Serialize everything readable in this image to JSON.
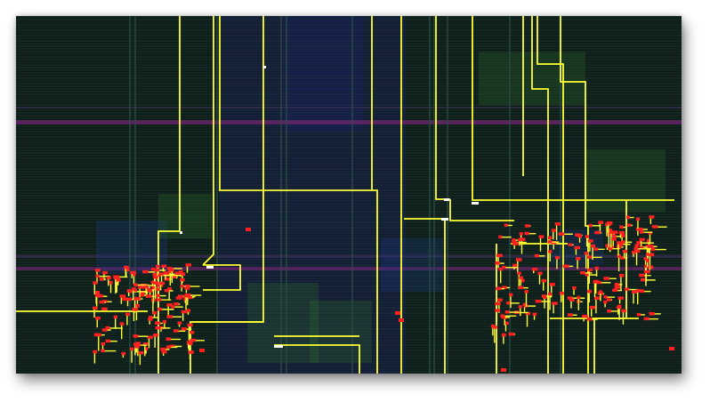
{
  "view": {
    "kind": "fpga-routing-layout",
    "palette": {
      "background": "#0d1b18",
      "scanline": "#1f3a30",
      "scanline_alt": "#23402f",
      "dark_band": "#141a3f",
      "magenta_band": "#8a1f86",
      "purple_band": "#4d2f6b",
      "grid_column": "#2a4a44",
      "route": "#ffff33",
      "cell": "#ff2020",
      "pin": "#ffffff",
      "green_tint": "#2f6b2a",
      "blue_tint": "#1e3a8a"
    },
    "regions": {
      "placed_cluster_left": "placed-logic-cluster-left",
      "placed_cluster_right": "placed-logic-cluster-right"
    }
  }
}
